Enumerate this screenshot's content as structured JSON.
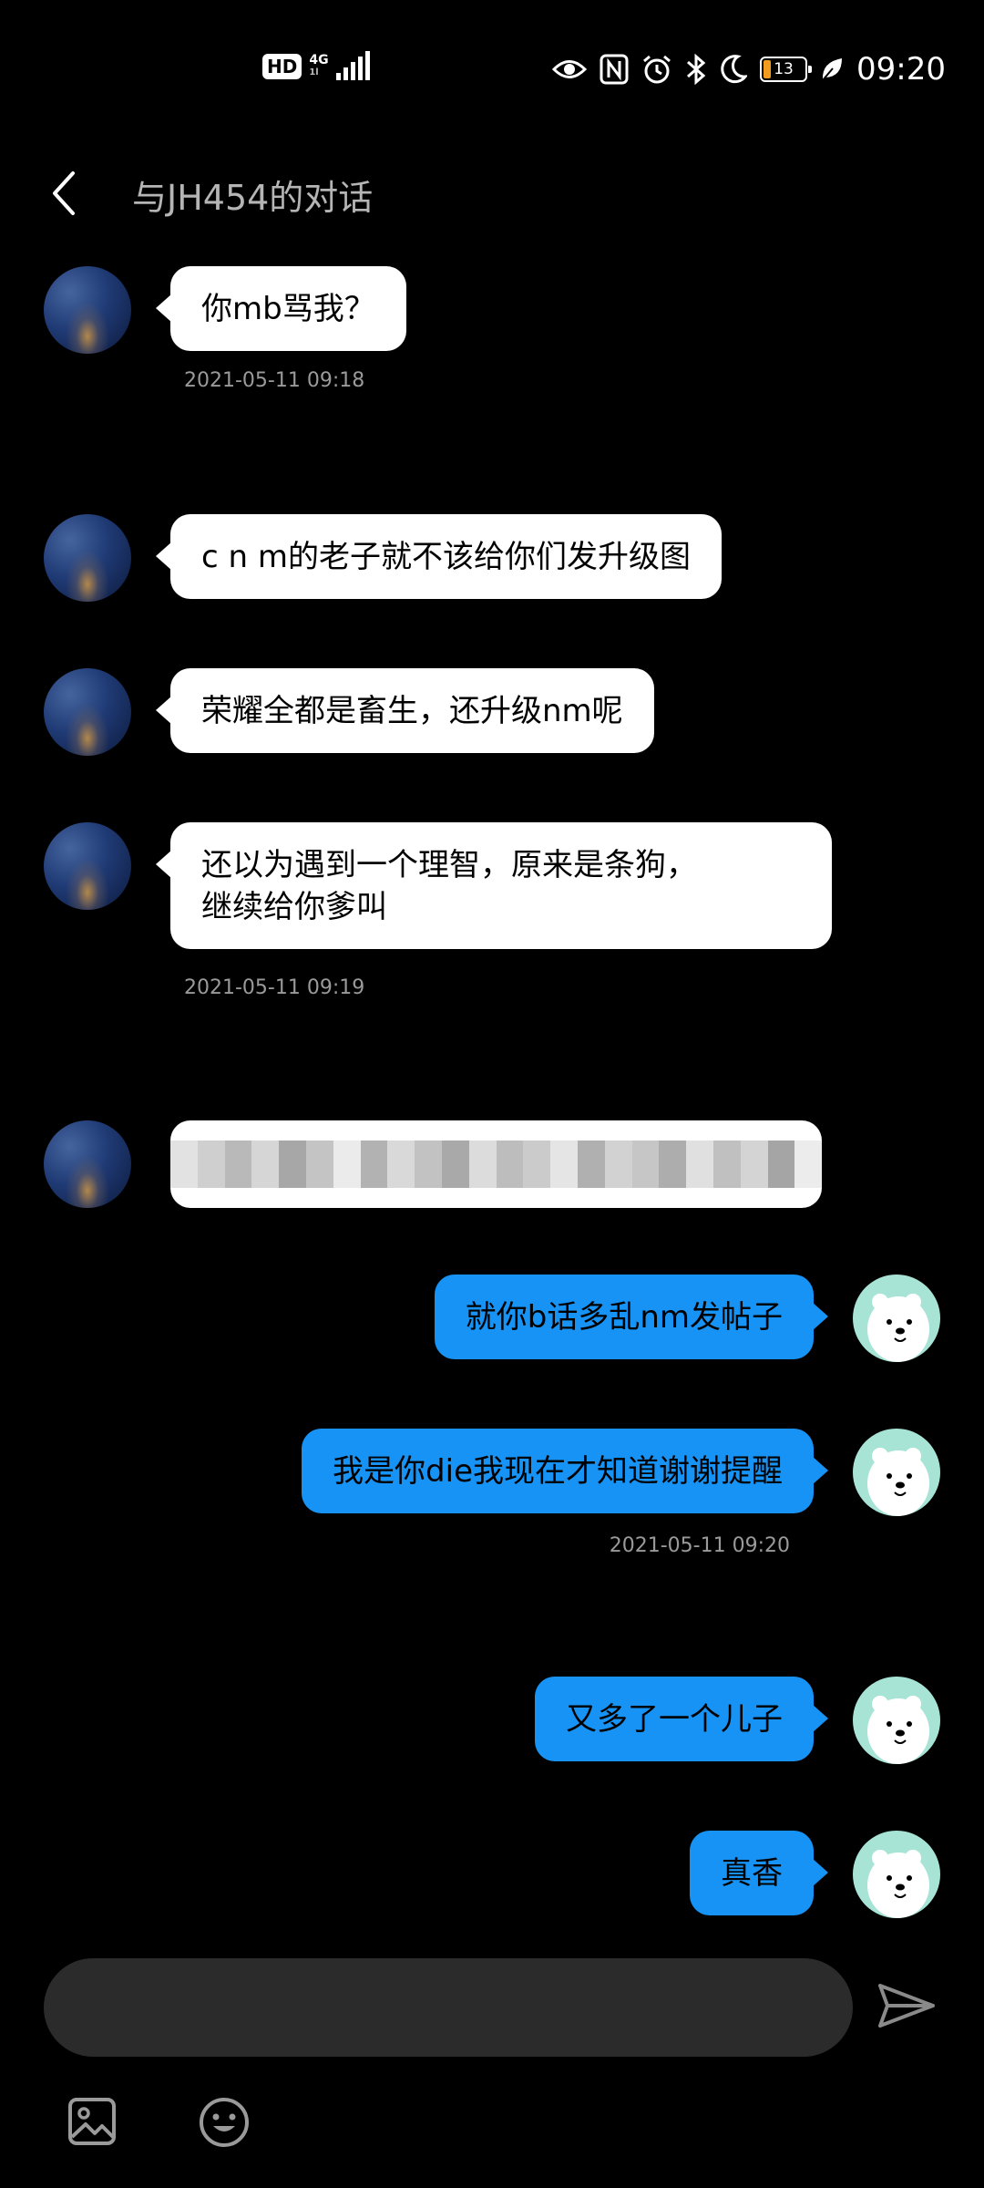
{
  "status_bar": {
    "hd": "HD",
    "network": "4G",
    "network_sub": "1l",
    "battery": "13",
    "time": "09:20"
  },
  "header": {
    "title": "与JH454的对话"
  },
  "messages": [
    {
      "dir": "in",
      "text": "你mb骂我？",
      "timestamp": "2021-05-11 09:18"
    },
    {
      "dir": "in",
      "text": "c n m的老子就不该给你们发升级图"
    },
    {
      "dir": "in",
      "text": "荣耀全都是畜生，还升级nm呢"
    },
    {
      "dir": "in",
      "text_line1": "还以为遇到一个理智，原来是条狗，",
      "text_line2": "继续给你爹叫",
      "timestamp": "2021-05-11 09:19"
    },
    {
      "dir": "in",
      "censored": true
    },
    {
      "dir": "out",
      "text": "就你b话多乱nm发帖子"
    },
    {
      "dir": "out",
      "text": "我是你die我现在才知道谢谢提醒",
      "timestamp": "2021-05-11 09:20"
    },
    {
      "dir": "out",
      "text": "又多了一个儿子"
    },
    {
      "dir": "out",
      "text": "真香"
    }
  ],
  "composer": {
    "placeholder": "",
    "icons": [
      "send-icon",
      "image-icon",
      "emoji-icon"
    ]
  },
  "colors": {
    "background": "#000000",
    "incoming_bubble": "#ffffff",
    "outgoing_bubble": "#1793f5",
    "input_bar": "#2b2b2b",
    "timestamp": "#9a9a9a"
  }
}
